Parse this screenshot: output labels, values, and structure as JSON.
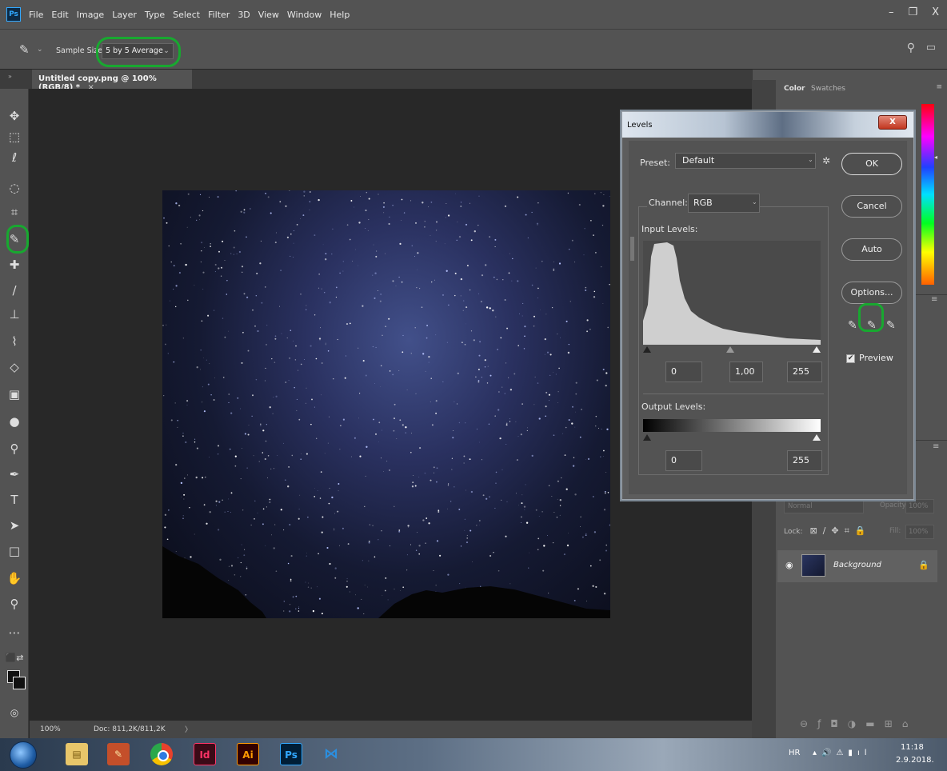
{
  "app": {
    "logo_text": "Ps"
  },
  "menu": [
    "File",
    "Edit",
    "Image",
    "Layer",
    "Type",
    "Select",
    "Filter",
    "3D",
    "View",
    "Window",
    "Help"
  ],
  "window_controls": {
    "minimize": "–",
    "restore": "❐",
    "close": "X"
  },
  "options_bar": {
    "tool_icon": "eyedropper-icon",
    "sample_size_label": "Sample Size:",
    "sample_size_value": "5 by 5 Average"
  },
  "document": {
    "tab_title": "Untitled copy.png @ 100% (RGB/8) *",
    "tab_close": "×"
  },
  "status_bar": {
    "zoom": "100%",
    "doc_size": "Doc: 811,2K/811,2K",
    "arrow": "〉"
  },
  "color_panel": {
    "tab_color": "Color",
    "tab_swatches": "Swatches"
  },
  "layers_panel": {
    "blend_mode": "Normal",
    "opacity_label": "Opacity:",
    "opacity_value": "100%",
    "lock_label": "Lock:",
    "fill_label": "Fill:",
    "fill_value": "100%",
    "layer_name": "Background"
  },
  "levels": {
    "title": "Levels",
    "close": "X",
    "preset_label": "Preset:",
    "preset_value": "Default",
    "channel_label": "Channel:",
    "channel_value": "RGB",
    "input_label": "Input Levels:",
    "input_black": "0",
    "input_gamma": "1,00",
    "input_white": "255",
    "output_label": "Output Levels:",
    "output_black": "0",
    "output_white": "255",
    "buttons": {
      "ok": "OK",
      "cancel": "Cancel",
      "auto": "Auto",
      "options": "Options..."
    },
    "preview_label": "Preview",
    "preview_checked": true
  },
  "taskbar": {
    "apps": [
      "Id",
      "Ai",
      "Ps"
    ],
    "lang": "HR",
    "time": "11:18",
    "date": "2.9.2018."
  }
}
